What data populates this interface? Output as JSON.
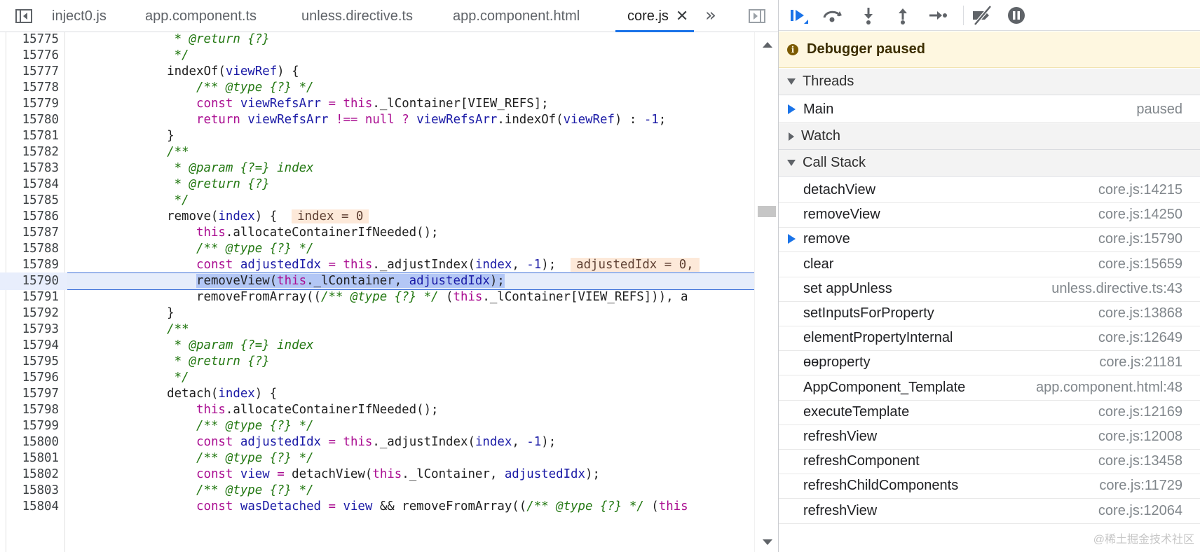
{
  "tabs": [
    {
      "label": "inject0.js"
    },
    {
      "label": "app.component.ts"
    },
    {
      "label": "unless.directive.ts"
    },
    {
      "label": "app.component.html"
    },
    {
      "label": "core.js",
      "active": true
    }
  ],
  "tab_close_glyph": "✕",
  "more_tabs_glyph": "»",
  "code": {
    "current_line": 15790,
    "lines": [
      {
        "n": "15775",
        "t": "              * @return {?}"
      },
      {
        "n": "15776",
        "t": "              */"
      },
      {
        "n": "15777",
        "t": "             indexOf(viewRef) {"
      },
      {
        "n": "15778",
        "t": "                 /** @type {?} */"
      },
      {
        "n": "15779",
        "t": "                 const viewRefsArr = this._lContainer[VIEW_REFS];"
      },
      {
        "n": "15780",
        "t": "                 return viewRefsArr !== null ? viewRefsArr.indexOf(viewRef) : -1;"
      },
      {
        "n": "15781",
        "t": "             }"
      },
      {
        "n": "15782",
        "t": "             /**"
      },
      {
        "n": "15783",
        "t": "              * @param {?=} index"
      },
      {
        "n": "15784",
        "t": "              * @return {?}"
      },
      {
        "n": "15785",
        "t": "              */"
      },
      {
        "n": "15786",
        "t": "             remove(index) {"
      },
      {
        "n": "15787",
        "t": "                 this.allocateContainerIfNeeded();"
      },
      {
        "n": "15788",
        "t": "                 /** @type {?} */"
      },
      {
        "n": "15789",
        "t": "                 const adjustedIdx = this._adjustIndex(index, -1);"
      },
      {
        "n": "15790",
        "t": "                 removeView(this._lContainer, adjustedIdx);"
      },
      {
        "n": "15791",
        "t": "                 removeFromArray((/** @type {?} */ (this._lContainer[VIEW_REFS])), a"
      },
      {
        "n": "15792",
        "t": "             }"
      },
      {
        "n": "15793",
        "t": "             /**"
      },
      {
        "n": "15794",
        "t": "              * @param {?=} index"
      },
      {
        "n": "15795",
        "t": "              * @return {?}"
      },
      {
        "n": "15796",
        "t": "              */"
      },
      {
        "n": "15797",
        "t": "             detach(index) {"
      },
      {
        "n": "15798",
        "t": "                 this.allocateContainerIfNeeded();"
      },
      {
        "n": "15799",
        "t": "                 /** @type {?} */"
      },
      {
        "n": "15800",
        "t": "                 const adjustedIdx = this._adjustIndex(index, -1);"
      },
      {
        "n": "15801",
        "t": "                 /** @type {?} */"
      },
      {
        "n": "15802",
        "t": "                 const view = detachView(this._lContainer, adjustedIdx);"
      },
      {
        "n": "15803",
        "t": "                 /** @type {?} */"
      },
      {
        "n": "15804",
        "t": "                 const wasDetached = view && removeFromArray((/** @type {?} */ (this"
      }
    ],
    "inline_values": [
      {
        "line": "15786",
        "text": "index = 0"
      },
      {
        "line": "15789",
        "text": "adjustedIdx = 0,"
      }
    ]
  },
  "debugger": {
    "toolbar": [
      {
        "name": "resume-button",
        "icon": "resume-icon"
      },
      {
        "name": "step-over-button",
        "icon": "step-over-icon"
      },
      {
        "name": "step-into-button",
        "icon": "step-into-icon"
      },
      {
        "name": "step-out-button",
        "icon": "step-out-icon"
      },
      {
        "name": "step-button",
        "icon": "step-icon"
      },
      {
        "name": "deactivate-breakpoints-button",
        "icon": "deactivate-breakpoints-icon"
      },
      {
        "name": "pause-on-exceptions-button",
        "icon": "pause-on-exceptions-icon"
      }
    ],
    "status": "Debugger paused",
    "threads_label": "Threads",
    "thread": {
      "name": "Main",
      "state": "paused"
    },
    "watch_label": "Watch",
    "callstack_label": "Call Stack",
    "callstack": [
      {
        "name": "detachView",
        "loc": "core.js:14215"
      },
      {
        "name": "removeView",
        "loc": "core.js:14250"
      },
      {
        "name": "remove",
        "loc": "core.js:15790",
        "current": true
      },
      {
        "name": "clear",
        "loc": "core.js:15659"
      },
      {
        "name": "set appUnless",
        "loc": "unless.directive.ts:43"
      },
      {
        "name": "setInputsForProperty",
        "loc": "core.js:13868"
      },
      {
        "name": "elementPropertyInternal",
        "loc": "core.js:12649"
      },
      {
        "name": "ɵɵproperty",
        "loc": "core.js:21181"
      },
      {
        "name": "AppComponent_Template",
        "loc": "app.component.html:48"
      },
      {
        "name": "executeTemplate",
        "loc": "core.js:12169"
      },
      {
        "name": "refreshView",
        "loc": "core.js:12008"
      },
      {
        "name": "refreshComponent",
        "loc": "core.js:13458"
      },
      {
        "name": "refreshChildComponents",
        "loc": "core.js:11729"
      },
      {
        "name": "refreshView",
        "loc": "core.js:12064"
      }
    ],
    "watermark": "@稀土掘金技术社区"
  }
}
